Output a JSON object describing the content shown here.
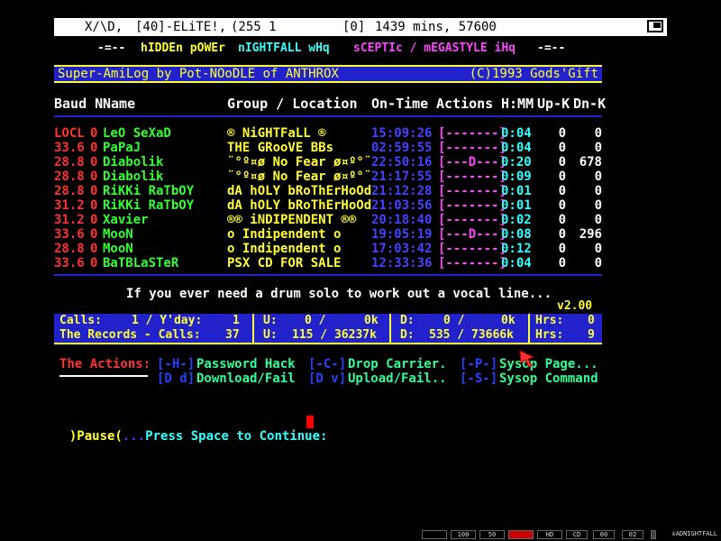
{
  "statusbar": {
    "user": "X/\\D,",
    "node_info": "[40]-ELiTE!,",
    "level": "(255 1",
    "zero": "[0]",
    "time": "1439 mins, 57600"
  },
  "subtitle": {
    "left_dash": "-=--",
    "hidden_power": "hIDDEn pOWEr",
    "nightfall": "nIGHTFALL wHq",
    "sceptic": "sCEPTIc / mEGASTYLE iHq",
    "right_dash": "-=--"
  },
  "title_bar": {
    "left": "Super-AmiLog by Pot-NOoDLE of ANTHROX",
    "right": "(C)1993 Gods'Gift"
  },
  "headers": {
    "baud_n": "Baud N",
    "name": "Name",
    "group": "Group / Location",
    "ontime": "On-Time",
    "actions": "Actions",
    "hmm": "H:MM",
    "upk": "Up-K",
    "dnk": "Dn-K"
  },
  "rows": [
    {
      "baud": "LOCL",
      "node": "0",
      "name": "LeO SeXaD",
      "group": "® NiGHTFaLL ®",
      "time": "15:09:26",
      "actions": "[-------]",
      "hmm": "0:04",
      "upk": "0",
      "dnk": "0"
    },
    {
      "baud": "33.6",
      "node": "0",
      "name": "PaPaJ",
      "group": "THE GRooVE BBs",
      "time": "02:59:55",
      "actions": "[-------]",
      "hmm": "0:04",
      "upk": "0",
      "dnk": "0"
    },
    {
      "baud": "28.8",
      "node": "0",
      "name": "Diabolik",
      "group": "¨°º¤ø No Fear ø¤º°¨",
      "time": "22:50:16",
      "actions": "[---D---]",
      "hmm": "0:20",
      "upk": "0",
      "dnk": "678"
    },
    {
      "baud": "28.8",
      "node": "0",
      "name": "Diabolik",
      "group": "¨°º¤ø No Fear ø¤º°¨",
      "time": "21:17:55",
      "actions": "[-------]",
      "hmm": "0:09",
      "upk": "0",
      "dnk": "0"
    },
    {
      "baud": "28.8",
      "node": "0",
      "name": "RiKKi RaTbOY",
      "group": "dA hOLY bRoThErHoOd",
      "time": "21:12:28",
      "actions": "[-------]",
      "hmm": "0:01",
      "upk": "0",
      "dnk": "0"
    },
    {
      "baud": "31.2",
      "node": "0",
      "name": "RiKKi RaTbOY",
      "group": "dA hOLY bRoThErHoOd",
      "time": "21:03:56",
      "actions": "[-------]",
      "hmm": "0:01",
      "upk": "0",
      "dnk": "0"
    },
    {
      "baud": "31.2",
      "node": "0",
      "name": "Xavier",
      "group": "®® iNDIPENDENT ®®",
      "time": "20:18:40",
      "actions": "[-------]",
      "hmm": "0:02",
      "upk": "0",
      "dnk": "0"
    },
    {
      "baud": "33.6",
      "node": "0",
      "name": "MooN",
      "group": "o Indipendent o",
      "time": "19:05:19",
      "actions": "[---D---]",
      "hmm": "0:08",
      "upk": "0",
      "dnk": "296"
    },
    {
      "baud": "28.8",
      "node": "0",
      "name": "MooN",
      "group": "o Indipendent o",
      "time": "17:03:42",
      "actions": "[-------]",
      "hmm": "0:12",
      "upk": "0",
      "dnk": "0"
    },
    {
      "baud": "33.6",
      "node": "0",
      "name": "BaTBLaSTeR",
      "group": "PSX CD FOR SALE",
      "time": "12:33:36",
      "actions": "[-------]",
      "hmm": "0:04",
      "upk": "0",
      "dnk": "0"
    }
  ],
  "quote": "If you ever need a drum solo to work out a vocal line...",
  "version": "v2.00",
  "stats": {
    "calls_label": "Calls:",
    "calls_value": "1 / Y'day:",
    "yday_value": "1",
    "u1_label": "U:",
    "u1_value": "0 /",
    "u1_k": "0k",
    "d1_label": "D:",
    "d1_value": "0 /",
    "d1_k": "0k",
    "hrs1_label": "Hrs:",
    "hrs1_value": "0",
    "records_label": "The Records - Calls:",
    "records_value": "37",
    "u2_label": "U:",
    "u2_value": "115 / 36237k",
    "d2_label": "D:",
    "d2_value": "535 / 73666k",
    "hrs2_label": "Hrs:",
    "hrs2_value": "9"
  },
  "actions_section": {
    "title": "The Actions:",
    "items": [
      {
        "key": "[-H-]",
        "label": "Password Hack"
      },
      {
        "key": "[-C-]",
        "label": "Drop Carrier."
      },
      {
        "key": "[-P-]",
        "label": "Sysop Page..."
      },
      {
        "key": "[D d]",
        "label": "Download/Fail"
      },
      {
        "key": "[D v]",
        "label": "Upload/Fail.."
      },
      {
        "key": "[-S-]",
        "label": "Sysop Command"
      }
    ]
  },
  "prompt": {
    "open": ")Pause(",
    "dots": "...",
    "text": "Press Space to Continue:"
  },
  "taskbar": {
    "items": [
      "",
      "100",
      "50",
      "",
      "HD",
      "CD",
      "00",
      "02",
      "",
      "xADNIGHTFALL"
    ]
  },
  "colors": {
    "title_bg": "#2222cc",
    "accent_yellow": "#ffff33",
    "cursor_red": "#ff0000"
  }
}
